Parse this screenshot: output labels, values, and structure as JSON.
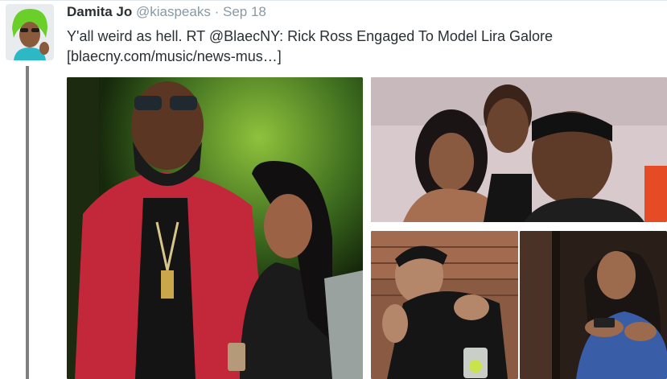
{
  "tweet": {
    "display_name": "Damita Jo",
    "handle": "@kiaspeaks",
    "separator": "·",
    "date": "Sep 18",
    "text_line1": "Y'all weird as hell. RT @BlaecNY: Rick Ross Engaged To Model Lira Galore",
    "text_line2": "[blaecny.com/music/news-mus…]"
  },
  "icons": {
    "avatar": "user-avatar",
    "thread": "thread-connector-line"
  }
}
